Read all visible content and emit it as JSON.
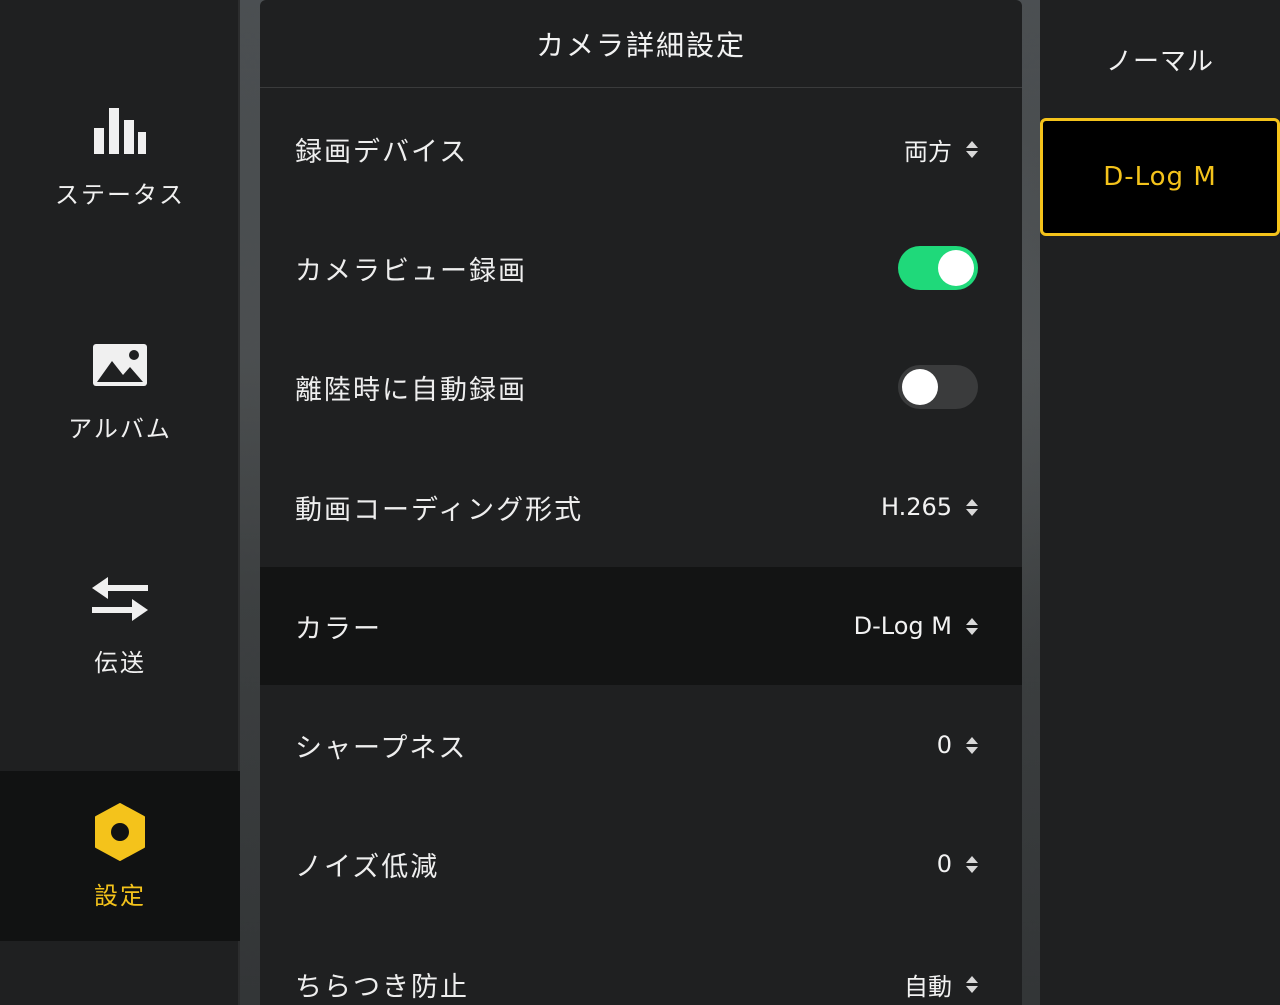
{
  "sidebar": {
    "items": [
      {
        "label": "ステータス",
        "icon": "bar-chart-icon",
        "active": false
      },
      {
        "label": "アルバム",
        "icon": "image-icon",
        "active": false
      },
      {
        "label": "伝送",
        "icon": "transfer-arrows-icon",
        "active": false
      },
      {
        "label": "設定",
        "icon": "hexagon-gear-icon",
        "active": true
      }
    ]
  },
  "panel": {
    "title": "カメラ詳細設定",
    "rows": [
      {
        "label": "録画デバイス",
        "value": "両方",
        "type": "select"
      },
      {
        "label": "カメラビュー録画",
        "type": "toggle",
        "state": "on"
      },
      {
        "label": "離陸時に自動録画",
        "type": "toggle",
        "state": "off"
      },
      {
        "label": "動画コーディング形式",
        "value": "H.265",
        "type": "select"
      },
      {
        "label": "カラー",
        "value": "D-Log M",
        "type": "select",
        "highlighted": true
      },
      {
        "label": "シャープネス",
        "value": "0",
        "type": "select"
      },
      {
        "label": "ノイズ低減",
        "value": "0",
        "type": "select"
      },
      {
        "label": "ちらつき防止",
        "value": "自動",
        "type": "select"
      }
    ]
  },
  "color_options": {
    "items": [
      {
        "label": "ノーマル",
        "selected": false
      },
      {
        "label": "D-Log M",
        "selected": true
      }
    ]
  },
  "colors": {
    "accent": "#f4c31b",
    "toggle_on": "#1fd97a",
    "panel_bg": "#1f2021",
    "highlight_bg": "#131414"
  }
}
